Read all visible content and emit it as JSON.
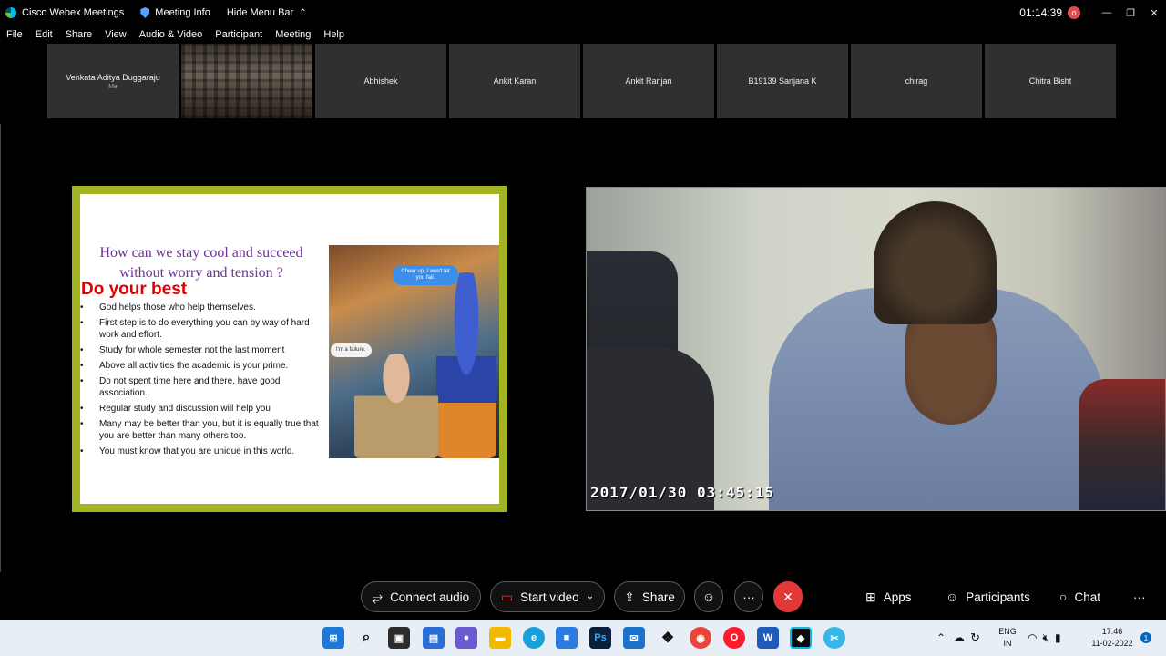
{
  "titlebar": {
    "app_name": "Cisco Webex Meetings",
    "meeting_info": "Meeting Info",
    "hide_menu": "Hide Menu Bar",
    "timer": "01:14:39",
    "rec_indicator": "o"
  },
  "menu": [
    "File",
    "Edit",
    "Share",
    "View",
    "Audio & Video",
    "Participant",
    "Meeting",
    "Help"
  ],
  "participants": [
    {
      "name": "Venkata Aditya Duggaraju",
      "sub": "Me"
    },
    {
      "name": "",
      "sub": ""
    },
    {
      "name": "Abhishek",
      "sub": ""
    },
    {
      "name": "Ankit Karan",
      "sub": ""
    },
    {
      "name": "Ankit Ranjan",
      "sub": ""
    },
    {
      "name": "B19139 Sanjana K",
      "sub": ""
    },
    {
      "name": "chirag",
      "sub": ""
    },
    {
      "name": "Chitra Bisht",
      "sub": ""
    }
  ],
  "slide": {
    "title": "How can we stay cool and succeed without worry and tension ?",
    "heading": "Do your best",
    "bullets": [
      "God helps those who help themselves.",
      "First step is to do everything you can by way of hard work and effort.",
      "Study for whole semester not the last moment",
      "Above all activities the academic is your prime.",
      "Do not spent time here and there, have good association.",
      "Regular study and discussion will help you",
      "Many may be better than you, but it is equally true that you are better than many others too.",
      "You must know that you are unique in this world."
    ],
    "bubble_blue": "Cheer up, I won't let you fail.",
    "bubble_white": "I'm a failure."
  },
  "camera": {
    "timestamp": "2017/01/30 03:45:15"
  },
  "controls": {
    "connect_audio": "Connect audio",
    "start_video": "Start video",
    "share": "Share",
    "more": "···",
    "apps": "Apps",
    "participants": "Participants",
    "chat": "Chat",
    "overflow": "···"
  },
  "taskbar": {
    "lang_line1": "ENG",
    "lang_line2": "IN",
    "time": "17:46",
    "date": "11-02-2022",
    "notifications": "1",
    "icons": [
      "windows-start-icon",
      "search-icon",
      "task-view-icon",
      "widgets-icon",
      "teams-chat-icon",
      "file-explorer-icon",
      "edge-icon",
      "store-icon",
      "photoshop-icon",
      "mail-icon",
      "dropbox-icon",
      "chrome-icon",
      "opera-icon",
      "word-icon",
      "webex-icon",
      "snip-icon"
    ]
  },
  "colors": {
    "slide_border": "#a4b321",
    "slide_title": "#7030a0",
    "slide_heading": "#e00000",
    "end_call": "#e33838",
    "taskbar": "#e8eef5"
  }
}
